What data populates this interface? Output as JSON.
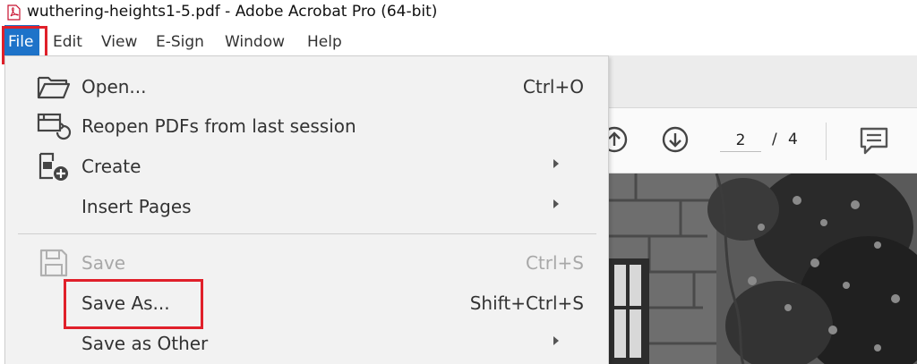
{
  "titlebar": {
    "title": "wuthering-heights1-5.pdf - Adobe Acrobat Pro (64-bit)",
    "icon": "acrobat-pdf-icon"
  },
  "menubar": {
    "file": "File",
    "items": [
      {
        "name": "edit",
        "label": "Edit"
      },
      {
        "name": "view",
        "label": "View"
      },
      {
        "name": "esign",
        "label": "E-Sign"
      },
      {
        "name": "window",
        "label": "Window"
      },
      {
        "name": "help",
        "label": "Help"
      }
    ]
  },
  "file_menu": {
    "open": {
      "label": "Open...",
      "shortcut": "Ctrl+O",
      "icon": "folder-open-icon"
    },
    "reopen": {
      "label": "Reopen PDFs from last session",
      "icon": "reopen-session-icon"
    },
    "create": {
      "label": "Create",
      "icon": "create-pdf-icon"
    },
    "insert_pages": {
      "label": "Insert Pages"
    },
    "save": {
      "label": "Save",
      "shortcut": "Ctrl+S",
      "icon": "floppy-disk-icon",
      "enabled": false
    },
    "save_as": {
      "label": "Save As...",
      "shortcut": "Shift+Ctrl+S"
    },
    "save_as_other": {
      "label": "Save as Other"
    }
  },
  "toolbar": {
    "current_page": "2",
    "page_separator": "/",
    "total_pages": "4"
  },
  "colors": {
    "menu_highlight": "#1e73c9",
    "annotation_red": "#e0202a",
    "menu_bg": "#f2f2f2"
  }
}
